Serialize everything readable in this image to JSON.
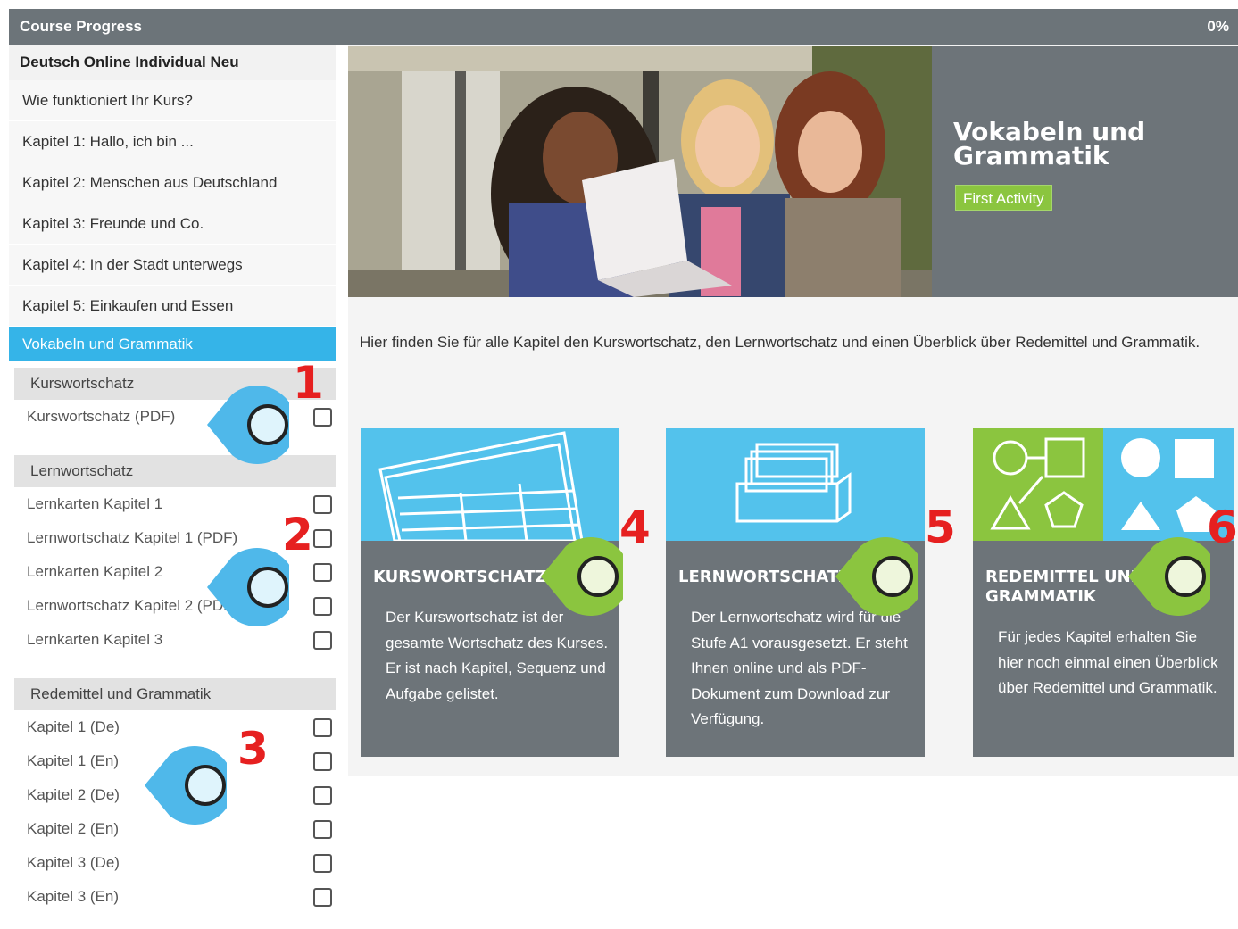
{
  "header": {
    "title": "Course Progress",
    "progress": "0%"
  },
  "sidebar": {
    "course_title": "Deutsch Online Individual Neu",
    "items": [
      {
        "label": "Wie funktioniert Ihr Kurs?"
      },
      {
        "label": "Kapitel 1: Hallo, ich bin ..."
      },
      {
        "label": "Kapitel 2: Menschen aus Deutschland"
      },
      {
        "label": "Kapitel 3: Freunde und Co."
      },
      {
        "label": "Kapitel 4: In der Stadt unterwegs"
      },
      {
        "label": "Kapitel 5: Einkaufen und Essen"
      }
    ],
    "active_item": "Vokabeln und Grammatik",
    "sections": [
      {
        "title": "Kurswortschatz",
        "items": [
          "Kurswortschatz (PDF)"
        ]
      },
      {
        "title": "Lernwortschatz",
        "items": [
          "Lernkarten Kapitel 1",
          "Lernwortschatz Kapitel 1 (PDF)",
          "Lernkarten Kapitel 2",
          "Lernwortschatz Kapitel 2 (PDF)",
          "Lernkarten Kapitel 3"
        ]
      },
      {
        "title": "Redemittel und Grammatik",
        "items": [
          "Kapitel 1 (De)",
          "Kapitel 1 (En)",
          "Kapitel 2 (De)",
          "Kapitel 2 (En)",
          "Kapitel 3 (De)",
          "Kapitel 3 (En)"
        ]
      }
    ]
  },
  "hero": {
    "title": "Vokabeln und Grammatik",
    "button": "First Activity"
  },
  "intro": "Hier finden Sie für alle Kapitel den Kurswortschatz, den Lernwortschatz und einen Überblick über Redemittel und Grammatik.",
  "cards": [
    {
      "title": "KURSWORTSCHATZ",
      "text": "Der Kurswortschatz ist der gesamte Wortschatz des Kurses. Er ist nach Kapitel, Sequenz und Aufgabe gelistet."
    },
    {
      "title": "LERNWORTSCHATZ",
      "text": "Der Lernwortschatz wird für die Stufe A1 vorausgesetzt. Er steht Ihnen online und als PDF-Dokument zum Download zur Verfügung."
    },
    {
      "title": "REDEMITTEL UND GRAMMATIK",
      "text": "Für jedes Kapitel erhalten Sie hier noch einmal einen Überblick über Redemittel und Grammatik."
    }
  ],
  "annotations": [
    "1",
    "2",
    "3",
    "4",
    "5",
    "6"
  ],
  "colors": {
    "accent_blue": "#35b4e8",
    "accent_green": "#8bc53f",
    "header_gray": "#6c7479",
    "annotation_red": "#e62020"
  }
}
